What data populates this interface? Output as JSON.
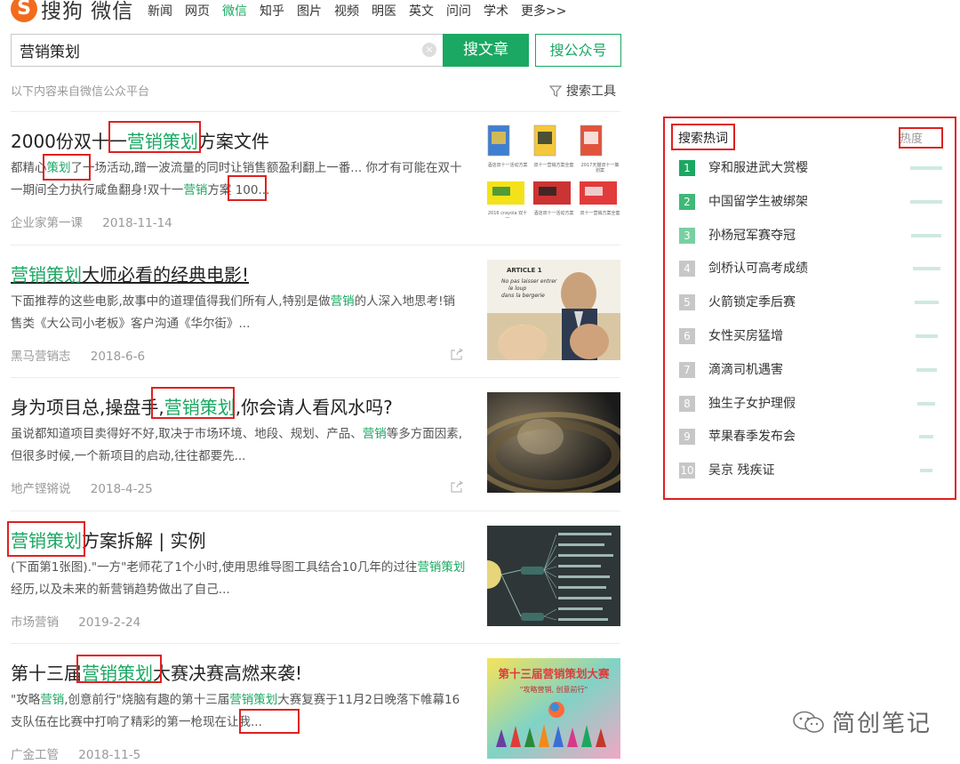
{
  "header": {
    "logo_letter": "S",
    "logo_text": "搜狗 微信",
    "nav": [
      "新闻",
      "网页",
      "微信",
      "知乎",
      "图片",
      "视频",
      "明医",
      "英文",
      "问问",
      "学术",
      "更多>>"
    ],
    "active_nav": "微信"
  },
  "search": {
    "query": "营销策划",
    "btn_article": "搜文章",
    "btn_account": "搜公众号",
    "source_note": "以下内容来自微信公众平台",
    "tools_label": "搜索工具"
  },
  "results": [
    {
      "title_before": "2000份双十一",
      "title_hl": "营销策划",
      "title_after": "方案文件",
      "snippet_html": "都精心<span class=\"hl\">策划</span>了一场活动,蹭一波流量的同时让销售额盈利翻上一番... 你才有可能在双十一期间全力执行咸鱼翻身!双十一<span class=\"hl\">营销</span>方案 100...",
      "source": "企业家第一课",
      "date": "2018-11-14"
    },
    {
      "title_before": "",
      "title_hl": "营销策划",
      "title_after": "大师必看的经典电影!",
      "snippet_html": "下面推荐的这些电影,故事中的道理值得我们所有人,特别是做<span class=\"hl\">营销</span>的人深入地思考!销售类《大公司小老板》客户沟通《华尔街》...",
      "source": "黑马营销志",
      "date": "2018-6-6"
    },
    {
      "title_before": "身为项目总,操盘手,",
      "title_hl": "营销策划",
      "title_after": ",你会请人看风水吗?",
      "snippet_html": "虽说都知道项目卖得好不好,取决于市场环境、地段、规划、产品、<span class=\"hl\">营销</span>等多方面因素,但很多时候,一个新项目的启动,往往都要先...",
      "source": "地产铿锵说",
      "date": "2018-4-25"
    },
    {
      "title_before": "",
      "title_hl": "营销策划",
      "title_after": "方案拆解 | 实例",
      "snippet_html": "(下面第1张图).\"一方\"老师花了1个小时,使用思维导图工具结合10几年的过往<span class=\"hl\">营销策划</span>经历,以及未来的新营销趋势做出了自己...",
      "source": "市场营销",
      "date": "2019-2-24"
    },
    {
      "title_before": "第十三届",
      "title_hl": "营销策划",
      "title_after": "大赛决赛高燃来袭!",
      "snippet_html": "\"攻略<span class=\"hl\">营销</span>,创意前行\"烧脑有趣的第十三届<span class=\"hl\">营销策划</span>大赛复赛于11月2日晚落下帷幕16支队伍在比赛中打响了精彩的第一枪现在让我...",
      "source": "广金工管",
      "date": "2018-11-5"
    }
  ],
  "thumbs": {
    "file_captions": [
      "酒店双十一活动方案",
      "双十一营销方案全套",
      "2017天猫双十一策划案",
      "2016 crayola 双十一"
    ],
    "movie_poster_text": [
      "ARTICLE 1",
      "No pas laisser entrer",
      "le loup",
      "dans la bergerie"
    ],
    "contest_title": "第十三届营销策划大赛",
    "contest_slogan": "\"攻略营销, 创意前行\""
  },
  "hot": {
    "title": "搜索热词",
    "heat_label": "热度",
    "items": [
      {
        "rank": "1",
        "text": "穿和服进武大赏樱",
        "heat": 1.0
      },
      {
        "rank": "2",
        "text": "中国留学生被绑架",
        "heat": 1.0
      },
      {
        "rank": "3",
        "text": "孙杨冠军赛夺冠",
        "heat": 0.95
      },
      {
        "rank": "4",
        "text": "剑桥认可高考成绩",
        "heat": 0.85
      },
      {
        "rank": "5",
        "text": "火箭锁定季后赛",
        "heat": 0.75
      },
      {
        "rank": "6",
        "text": "女性买房猛增",
        "heat": 0.7
      },
      {
        "rank": "7",
        "text": "滴滴司机遇害",
        "heat": 0.65
      },
      {
        "rank": "8",
        "text": "独生子女护理假",
        "heat": 0.55
      },
      {
        "rank": "9",
        "text": "苹果春季发布会",
        "heat": 0.45
      },
      {
        "rank": "10",
        "text": "吴京 残疾证",
        "heat": 0.4
      }
    ],
    "rank_colors": [
      "#1aa862",
      "#3fb878",
      "#78cfa2",
      "#c7c7c7",
      "#c7c7c7",
      "#c7c7c7",
      "#c7c7c7",
      "#c7c7c7",
      "#c7c7c7",
      "#c7c7c7"
    ]
  },
  "watermark": "简创笔记"
}
